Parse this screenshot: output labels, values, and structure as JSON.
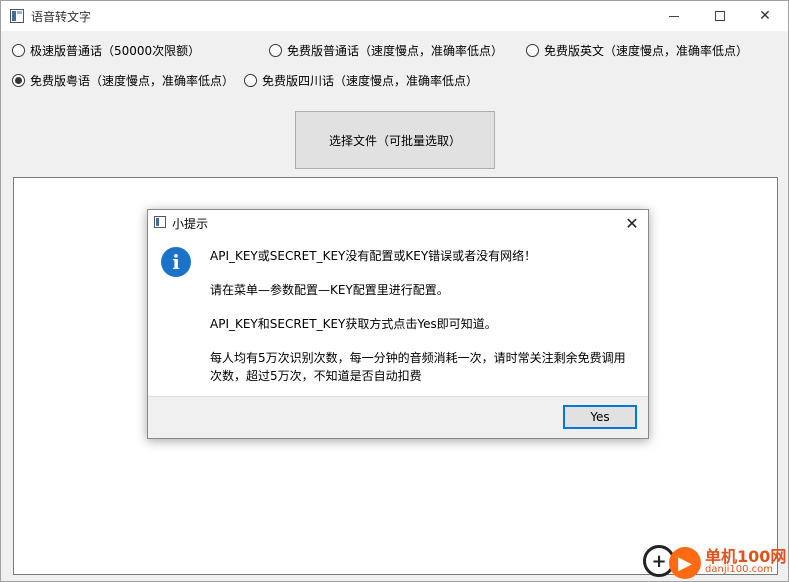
{
  "window": {
    "title": "语音转文字"
  },
  "options": [
    {
      "label": "极速版普通话（50000次限额）",
      "checked": false
    },
    {
      "label": "免费版普通话（速度慢点，准确率低点）",
      "checked": false
    },
    {
      "label": "免费版英文（速度慢点，准确率低点）",
      "checked": false
    },
    {
      "label": "免费版粤语（速度慢点，准确率低点）",
      "checked": true
    },
    {
      "label": "免费版四川话（速度慢点，准确率低点）",
      "checked": false
    }
  ],
  "select_file_label": "选择文件（可批量选取）",
  "dialog": {
    "title": "小提示",
    "close_glyph": "✕",
    "icon_glyph": "i",
    "lines": [
      "API_KEY或SECRET_KEY没有配置或KEY错误或者没有网络！",
      "请在菜单—参数配置—KEY配置里进行配置。",
      "API_KEY和SECRET_KEY获取方式点击Yes即可知道。",
      "每人均有5万次识别次数，每一分钟的音频消耗一次，请时常关注剩余免费调用次数，超过5万次，不知道是否自动扣费"
    ],
    "yes_label": "Yes"
  },
  "watermark": {
    "text": "单机100网",
    "sub": "danji100.com"
  },
  "icons": {
    "app": "app-window-icon",
    "info": "info-icon",
    "close": "close-icon"
  }
}
